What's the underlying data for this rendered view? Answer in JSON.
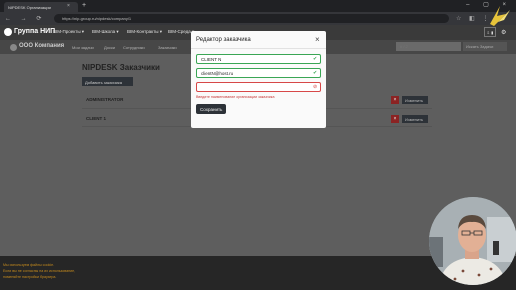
{
  "browser": {
    "tab_title": "NIPDESK Организации",
    "tab_close": "×",
    "new_tab": "+",
    "window_controls": "– ▢ ×",
    "nav_buttons": "← → ⟳",
    "url": "https://nip-group.ru/nipdesk/company/1",
    "extensions": "☆ ◧ ⋮"
  },
  "appbar": {
    "brand": "Группа НИП",
    "menus": [
      "BIM-Проекты ▾",
      "BIM-Школа ▾",
      "BIM-Контракты ▾",
      "BIM-Среда ▾"
    ],
    "user_label": "⇩ ▮"
  },
  "subbar": {
    "company": "ООО Компания",
    "links": [
      "Мои задачи",
      "Доски",
      "Сотрудники",
      "Заказчики"
    ],
    "search_placeholder": "# / 2",
    "search_button": "Искать Задачи"
  },
  "page": {
    "title": "NIPDESK Заказчики",
    "add_button": "Добавить заказчика",
    "rows": [
      {
        "name": "ADMINISTRATOR",
        "delete": "×",
        "edit": "Изменить"
      },
      {
        "name": "CLIENT 1",
        "delete": "×",
        "edit": "Изменить"
      }
    ]
  },
  "modal": {
    "title": "Редактор заказчика",
    "close": "×",
    "fields": [
      {
        "value": "CLIENT N",
        "status_icon": "✔"
      },
      {
        "value": "clientN@host.ru",
        "status_icon": "✔"
      },
      {
        "value": "",
        "status_icon": "⊘"
      }
    ],
    "error": "Введите наименование организации заказчика",
    "save": "Сохранить"
  },
  "cookies": {
    "lines": [
      "Мы используем файлы cookie.",
      "Если вы не согласны на их использование,",
      "поменяйте настройки браузера."
    ]
  },
  "colors": {
    "ok": "#3aa655",
    "error": "#d74848",
    "cookie_text": "#c48a1d",
    "button_dark": "#2d3238"
  }
}
